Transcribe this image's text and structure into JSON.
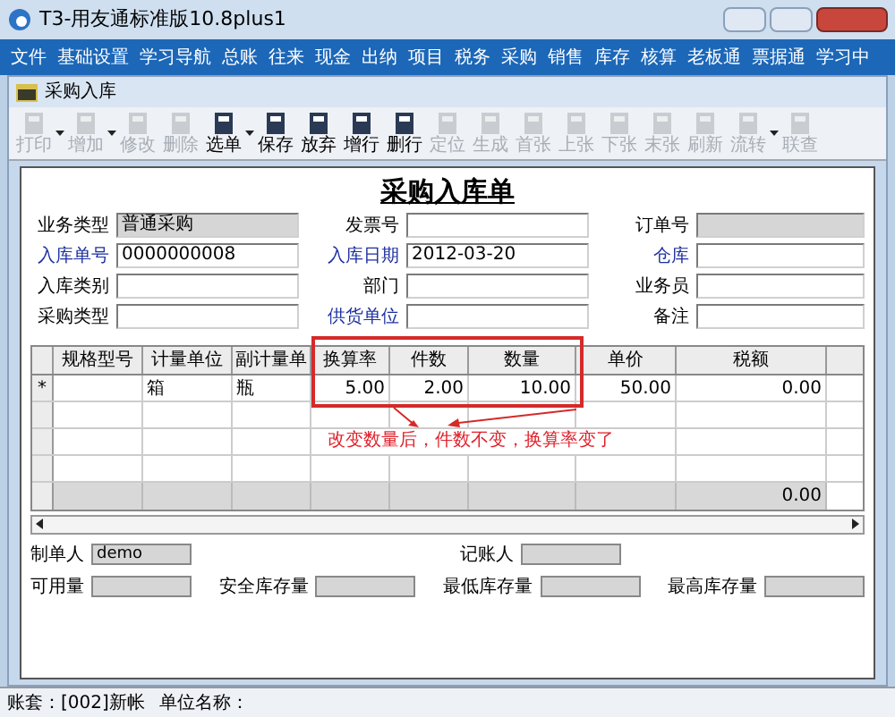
{
  "window": {
    "title": "T3-用友通标准版10.8plus1"
  },
  "menu": [
    "文件",
    "基础设置",
    "学习导航",
    "总账",
    "往来",
    "现金",
    "出纳",
    "项目",
    "税务",
    "采购",
    "销售",
    "库存",
    "核算",
    "老板通",
    "票据通",
    "学习中"
  ],
  "doc_window": {
    "title": "采购入库"
  },
  "toolbar": [
    {
      "label": "打印",
      "disabled": true,
      "dropdown": true
    },
    {
      "label": "增加",
      "disabled": true,
      "dropdown": true
    },
    {
      "label": "修改",
      "disabled": true,
      "dropdown": false
    },
    {
      "label": "删除",
      "disabled": true,
      "dropdown": false
    },
    {
      "label": "选单",
      "disabled": false,
      "dropdown": true
    },
    {
      "label": "保存",
      "disabled": false,
      "dropdown": false
    },
    {
      "label": "放弃",
      "disabled": false,
      "dropdown": false
    },
    {
      "label": "增行",
      "disabled": false,
      "dropdown": false
    },
    {
      "label": "删行",
      "disabled": false,
      "dropdown": false
    },
    {
      "label": "定位",
      "disabled": true,
      "dropdown": false
    },
    {
      "label": "生成",
      "disabled": true,
      "dropdown": false
    },
    {
      "label": "首张",
      "disabled": true,
      "dropdown": false
    },
    {
      "label": "上张",
      "disabled": true,
      "dropdown": false
    },
    {
      "label": "下张",
      "disabled": true,
      "dropdown": false
    },
    {
      "label": "末张",
      "disabled": true,
      "dropdown": false
    },
    {
      "label": "刷新",
      "disabled": true,
      "dropdown": false
    },
    {
      "label": "流转",
      "disabled": true,
      "dropdown": true
    },
    {
      "label": "联查",
      "disabled": true,
      "dropdown": false
    }
  ],
  "form_title": "采购入库单",
  "header_fields": [
    [
      {
        "label": "业务类型",
        "value": "普通采购",
        "required": false,
        "readonly": true
      },
      {
        "label": "发票号",
        "required": false,
        "readonly": false
      },
      {
        "label": "订单号",
        "required": false,
        "readonly": true
      }
    ],
    [
      {
        "label": "入库单号",
        "value": "0000000008",
        "required": true,
        "readonly": false
      },
      {
        "label": "入库日期",
        "value": "2012-03-20",
        "required": true,
        "readonly": false
      },
      {
        "label": "仓库",
        "required": true,
        "readonly": false
      }
    ],
    [
      {
        "label": "入库类别",
        "required": false,
        "readonly": false
      },
      {
        "label": "部门",
        "required": false,
        "readonly": false
      },
      {
        "label": "业务员",
        "required": false,
        "readonly": false
      }
    ],
    [
      {
        "label": "采购类型",
        "required": false,
        "readonly": false
      },
      {
        "label": "供货单位",
        "required": true,
        "readonly": false
      },
      {
        "label": "备注",
        "required": false,
        "readonly": false
      }
    ]
  ],
  "table": {
    "columns": [
      "规格型号",
      "计量单位",
      "副计量单",
      "换算率",
      "件数",
      "数量",
      "单价",
      "税额"
    ],
    "rows": [
      {
        "marker": "*",
        "cells": [
          "",
          "箱",
          "瓶",
          "5.00",
          "2.00",
          "10.00",
          "50.00",
          "0.00"
        ]
      }
    ],
    "total_row": {
      "value": "0.00"
    }
  },
  "annotation": "改变数量后，件数不变，换算率变了",
  "footer_fields": [
    [
      {
        "label": "制单人",
        "value": "demo"
      },
      {
        "label": "记账人"
      }
    ],
    [
      {
        "label": "可用量"
      },
      {
        "label": "安全库存量"
      },
      {
        "label": "最低库存量"
      },
      {
        "label": "最高库存量"
      }
    ]
  ],
  "status_bar": [
    "账套：[002]新帐",
    "单位名称："
  ]
}
